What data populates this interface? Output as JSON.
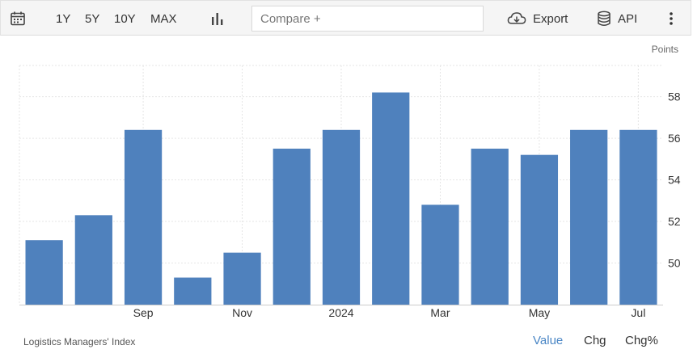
{
  "toolbar": {
    "ranges": [
      "1Y",
      "5Y",
      "10Y",
      "MAX"
    ],
    "compare_placeholder": "Compare +",
    "export_label": "Export",
    "api_label": "API"
  },
  "units_label": "Points",
  "footer": {
    "title": "Logistics Managers' Index",
    "tabs": [
      "Value",
      "Chg",
      "Chg%"
    ],
    "active_tab": "Value"
  },
  "colors": {
    "bar": "#4f81bd",
    "accent": "#4a86c5",
    "grid": "#e6e6e6"
  },
  "chart_data": {
    "type": "bar",
    "categories": [
      "2023-07",
      "2023-08",
      "2023-09",
      "2023-10",
      "2023-11",
      "2023-12",
      "2024-01",
      "2024-02",
      "2024-03",
      "2024-04",
      "2024-05",
      "2024-06",
      "2024-07"
    ],
    "x_tick_labels": {
      "2023-09": "Sep",
      "2023-11": "Nov",
      "2024-01": "2024",
      "2024-03": "Mar",
      "2024-05": "May",
      "2024-07": "Jul"
    },
    "values": [
      51.1,
      52.3,
      56.4,
      49.3,
      50.5,
      55.5,
      56.4,
      58.2,
      52.8,
      55.5,
      55.2,
      56.4,
      56.4
    ],
    "ylim": [
      48.0,
      59.5
    ],
    "yticks": [
      50,
      52,
      54,
      56,
      58
    ],
    "ylabel": "Points",
    "grid": true,
    "legend": "none"
  }
}
